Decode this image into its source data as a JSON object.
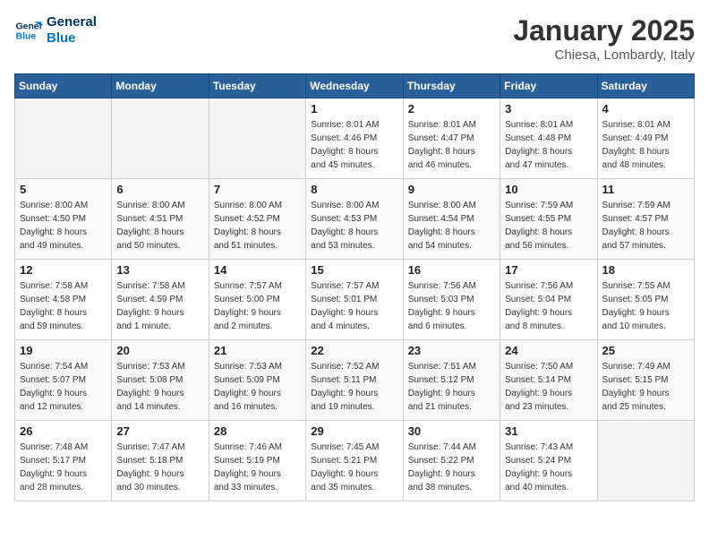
{
  "logo": {
    "line1": "General",
    "line2": "Blue"
  },
  "title": "January 2025",
  "subtitle": "Chiesa, Lombardy, Italy",
  "days_header": [
    "Sunday",
    "Monday",
    "Tuesday",
    "Wednesday",
    "Thursday",
    "Friday",
    "Saturday"
  ],
  "weeks": [
    [
      {
        "day": "",
        "info": ""
      },
      {
        "day": "",
        "info": ""
      },
      {
        "day": "",
        "info": ""
      },
      {
        "day": "1",
        "info": "Sunrise: 8:01 AM\nSunset: 4:46 PM\nDaylight: 8 hours\nand 45 minutes."
      },
      {
        "day": "2",
        "info": "Sunrise: 8:01 AM\nSunset: 4:47 PM\nDaylight: 8 hours\nand 46 minutes."
      },
      {
        "day": "3",
        "info": "Sunrise: 8:01 AM\nSunset: 4:48 PM\nDaylight: 8 hours\nand 47 minutes."
      },
      {
        "day": "4",
        "info": "Sunrise: 8:01 AM\nSunset: 4:49 PM\nDaylight: 8 hours\nand 48 minutes."
      }
    ],
    [
      {
        "day": "5",
        "info": "Sunrise: 8:00 AM\nSunset: 4:50 PM\nDaylight: 8 hours\nand 49 minutes."
      },
      {
        "day": "6",
        "info": "Sunrise: 8:00 AM\nSunset: 4:51 PM\nDaylight: 8 hours\nand 50 minutes."
      },
      {
        "day": "7",
        "info": "Sunrise: 8:00 AM\nSunset: 4:52 PM\nDaylight: 8 hours\nand 51 minutes."
      },
      {
        "day": "8",
        "info": "Sunrise: 8:00 AM\nSunset: 4:53 PM\nDaylight: 8 hours\nand 53 minutes."
      },
      {
        "day": "9",
        "info": "Sunrise: 8:00 AM\nSunset: 4:54 PM\nDaylight: 8 hours\nand 54 minutes."
      },
      {
        "day": "10",
        "info": "Sunrise: 7:59 AM\nSunset: 4:55 PM\nDaylight: 8 hours\nand 56 minutes."
      },
      {
        "day": "11",
        "info": "Sunrise: 7:59 AM\nSunset: 4:57 PM\nDaylight: 8 hours\nand 57 minutes."
      }
    ],
    [
      {
        "day": "12",
        "info": "Sunrise: 7:58 AM\nSunset: 4:58 PM\nDaylight: 8 hours\nand 59 minutes."
      },
      {
        "day": "13",
        "info": "Sunrise: 7:58 AM\nSunset: 4:59 PM\nDaylight: 9 hours\nand 1 minute."
      },
      {
        "day": "14",
        "info": "Sunrise: 7:57 AM\nSunset: 5:00 PM\nDaylight: 9 hours\nand 2 minutes."
      },
      {
        "day": "15",
        "info": "Sunrise: 7:57 AM\nSunset: 5:01 PM\nDaylight: 9 hours\nand 4 minutes."
      },
      {
        "day": "16",
        "info": "Sunrise: 7:56 AM\nSunset: 5:03 PM\nDaylight: 9 hours\nand 6 minutes."
      },
      {
        "day": "17",
        "info": "Sunrise: 7:56 AM\nSunset: 5:04 PM\nDaylight: 9 hours\nand 8 minutes."
      },
      {
        "day": "18",
        "info": "Sunrise: 7:55 AM\nSunset: 5:05 PM\nDaylight: 9 hours\nand 10 minutes."
      }
    ],
    [
      {
        "day": "19",
        "info": "Sunrise: 7:54 AM\nSunset: 5:07 PM\nDaylight: 9 hours\nand 12 minutes."
      },
      {
        "day": "20",
        "info": "Sunrise: 7:53 AM\nSunset: 5:08 PM\nDaylight: 9 hours\nand 14 minutes."
      },
      {
        "day": "21",
        "info": "Sunrise: 7:53 AM\nSunset: 5:09 PM\nDaylight: 9 hours\nand 16 minutes."
      },
      {
        "day": "22",
        "info": "Sunrise: 7:52 AM\nSunset: 5:11 PM\nDaylight: 9 hours\nand 19 minutes."
      },
      {
        "day": "23",
        "info": "Sunrise: 7:51 AM\nSunset: 5:12 PM\nDaylight: 9 hours\nand 21 minutes."
      },
      {
        "day": "24",
        "info": "Sunrise: 7:50 AM\nSunset: 5:14 PM\nDaylight: 9 hours\nand 23 minutes."
      },
      {
        "day": "25",
        "info": "Sunrise: 7:49 AM\nSunset: 5:15 PM\nDaylight: 9 hours\nand 25 minutes."
      }
    ],
    [
      {
        "day": "26",
        "info": "Sunrise: 7:48 AM\nSunset: 5:17 PM\nDaylight: 9 hours\nand 28 minutes."
      },
      {
        "day": "27",
        "info": "Sunrise: 7:47 AM\nSunset: 5:18 PM\nDaylight: 9 hours\nand 30 minutes."
      },
      {
        "day": "28",
        "info": "Sunrise: 7:46 AM\nSunset: 5:19 PM\nDaylight: 9 hours\nand 33 minutes."
      },
      {
        "day": "29",
        "info": "Sunrise: 7:45 AM\nSunset: 5:21 PM\nDaylight: 9 hours\nand 35 minutes."
      },
      {
        "day": "30",
        "info": "Sunrise: 7:44 AM\nSunset: 5:22 PM\nDaylight: 9 hours\nand 38 minutes."
      },
      {
        "day": "31",
        "info": "Sunrise: 7:43 AM\nSunset: 5:24 PM\nDaylight: 9 hours\nand 40 minutes."
      },
      {
        "day": "",
        "info": ""
      }
    ]
  ]
}
